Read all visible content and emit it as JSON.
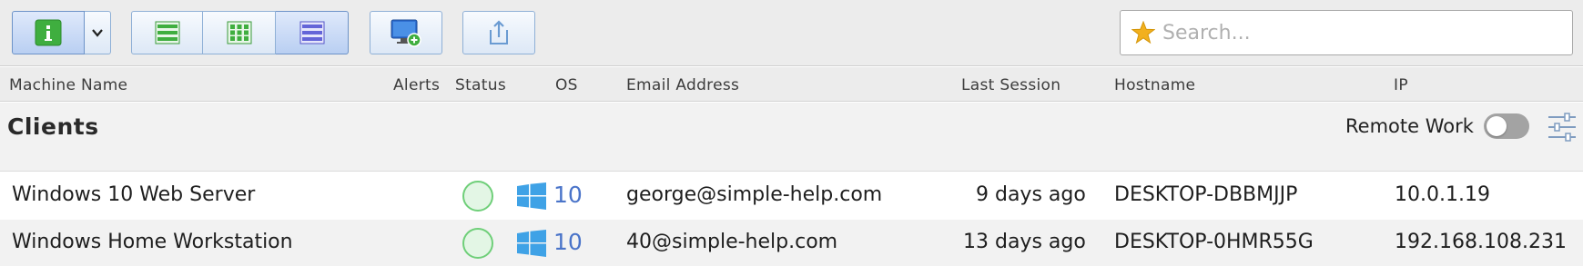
{
  "toolbar": {
    "info_button_icon": "info-icon",
    "dropdown_icon": "chevron-down-icon",
    "view_buttons": [
      {
        "icon": "list-view-icon"
      },
      {
        "icon": "grid-view-icon"
      },
      {
        "icon": "detail-view-icon"
      }
    ],
    "add_machine_icon": "monitor-add-icon",
    "export_icon": "export-icon",
    "accent_color": "#8fb0d6"
  },
  "search": {
    "placeholder": "Search...",
    "icon": "star-icon",
    "star_color": "#f2b01e"
  },
  "columns": {
    "machine_name": "Machine Name",
    "alerts": "Alerts",
    "status": "Status",
    "os": "OS",
    "email": "Email Address",
    "last_session": "Last Session",
    "hostname": "Hostname",
    "ip": "IP"
  },
  "group": {
    "title": "Clients",
    "remote_work_label": "Remote Work",
    "remote_work_enabled": false
  },
  "rows": [
    {
      "machine_name": "Windows 10 Web Server",
      "status_color": "#6fcf79",
      "os_version": "10",
      "email": "george@simple-help.com",
      "last_session": "9 days ago",
      "hostname": "DESKTOP-DBBMJJP",
      "ip": "10.0.1.19"
    },
    {
      "machine_name": "Windows Home Workstation",
      "status_color": "#6fcf79",
      "os_version": "10",
      "email": "40@simple-help.com",
      "last_session": "13 days ago",
      "hostname": "DESKTOP-0HMR55G",
      "ip": "192.168.108.231"
    }
  ]
}
